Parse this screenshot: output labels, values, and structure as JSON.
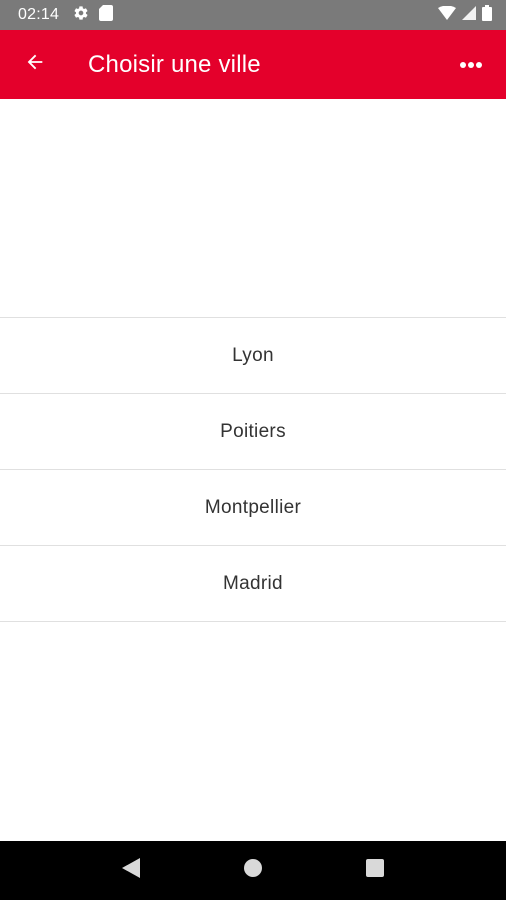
{
  "status_bar": {
    "time": "02:14",
    "left_icons": [
      "gear-icon",
      "sd-card-icon"
    ],
    "right_icons": [
      "wifi-icon",
      "signal-icon",
      "battery-icon"
    ]
  },
  "app_bar": {
    "title": "Choisir une ville",
    "back_icon": "arrow-left-icon",
    "more_icon": "more-horizontal-icon",
    "background_color": "#e4002b"
  },
  "cities": [
    {
      "label": "Lyon"
    },
    {
      "label": "Poitiers"
    },
    {
      "label": "Montpellier"
    },
    {
      "label": "Madrid"
    }
  ],
  "nav_bar": {
    "buttons": [
      "back-triangle-icon",
      "home-circle-icon",
      "recents-square-icon"
    ]
  }
}
